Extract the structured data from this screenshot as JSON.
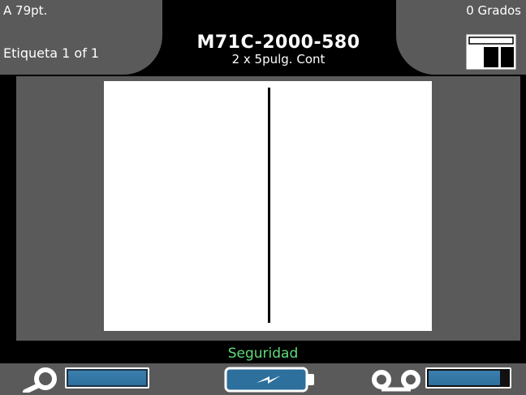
{
  "header": {
    "font_size": "A 79pt.",
    "rotation": "0 Grados",
    "label_count": "Etiqueta 1 of 1",
    "part_number": "M71C-2000-580",
    "label_size": "2 x 5pulg. Cont"
  },
  "status": {
    "text": "Seguridad"
  },
  "footer": {
    "feed_level": 1.0,
    "ribbon_level": 0.9,
    "icons": [
      "feed-icon",
      "battery-charging-icon",
      "ribbon-icon"
    ]
  },
  "colors": {
    "panel_grey": "#5a5a5a",
    "status_green": "#5fdc7a",
    "bar_blue": "#3b7fae"
  }
}
